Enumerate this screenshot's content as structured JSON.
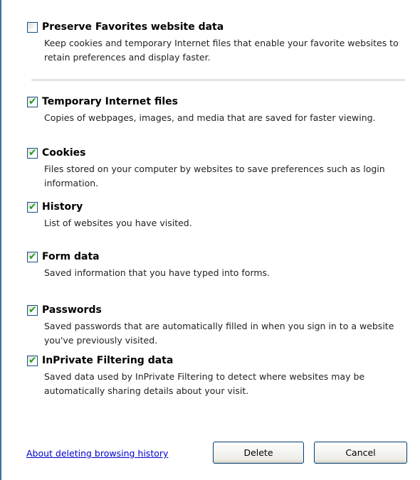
{
  "options": [
    {
      "title": "Preserve Favorites website data",
      "checked": false,
      "description": "Keep cookies and temporary Internet files that enable your favorite websites to retain preferences and display faster."
    },
    {
      "title": "Temporary Internet files",
      "checked": true,
      "description": "Copies of webpages, images, and media that are saved for faster viewing."
    },
    {
      "title": "Cookies",
      "checked": true,
      "description": "Files stored on your computer by websites to save preferences such as login information."
    },
    {
      "title": "History",
      "checked": true,
      "description": "List of websites you have visited."
    },
    {
      "title": "Form data",
      "checked": true,
      "description": "Saved information that you have typed into forms."
    },
    {
      "title": "Passwords",
      "checked": true,
      "description": "Saved passwords that are automatically filled in when you sign in to a website you've previously visited."
    },
    {
      "title": "InPrivate Filtering data",
      "checked": true,
      "description": "Saved data used by InPrivate Filtering to detect where websites may be automatically sharing details about your visit."
    }
  ],
  "footer": {
    "help_link": "About deleting browsing history",
    "delete_label": "Delete",
    "cancel_label": "Cancel"
  },
  "colors": {
    "checkmark": "#21a121",
    "checkbox_border": "#1c5180",
    "link": "#0000cc",
    "window_border": "#3a6ea5"
  },
  "icons": {
    "checkbox_checked": "checkmark-icon"
  }
}
